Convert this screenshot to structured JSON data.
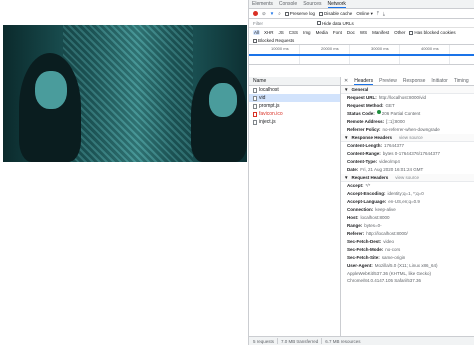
{
  "devtools": {
    "tabs": [
      "Elements",
      "Console",
      "Sources",
      "Network"
    ],
    "active_tab": "Network",
    "toolbar": {
      "preserve_log": "Preserve log",
      "disable_cache": "Disable cache",
      "throttle": "Online"
    },
    "filter": {
      "placeholder": "Filter",
      "hide_data_urls": "Hide data URLs"
    },
    "types": [
      "All",
      "XHR",
      "JS",
      "CSS",
      "Img",
      "Media",
      "Font",
      "Doc",
      "WS",
      "Manifest",
      "Other"
    ],
    "has_blocked_cookies": "Has blocked cookies",
    "blocked_requests": "Blocked Requests",
    "timeline_ticks": [
      "10000 ms",
      "20000 ms",
      "30000 ms",
      "40000 ms"
    ],
    "names_header": "Name",
    "requests": [
      {
        "name": "localhost"
      },
      {
        "name": "vid"
      },
      {
        "name": "prompt.js"
      },
      {
        "name": "favicon.ico"
      },
      {
        "name": "inject.js"
      }
    ],
    "detail_tabs": [
      "Headers",
      "Preview",
      "Response",
      "Initiator",
      "Timing"
    ],
    "general_title": "General",
    "general": [
      {
        "k": "Request URL:",
        "v": "http://localhost:8000/vid"
      },
      {
        "k": "Request Method:",
        "v": "GET"
      },
      {
        "k": "Status Code:",
        "v": "206 Partial Content"
      },
      {
        "k": "Remote Address:",
        "v": "[::1]:8000"
      },
      {
        "k": "Referrer Policy:",
        "v": "no-referrer-when-downgrade"
      }
    ],
    "response_title": "Response Headers",
    "view_source": "view source",
    "response_headers": [
      {
        "k": "Content-Length:",
        "v": "17644377"
      },
      {
        "k": "Content-Range:",
        "v": "bytes 0-17644376/17644377"
      },
      {
        "k": "Content-Type:",
        "v": "video/mp4"
      },
      {
        "k": "Date:",
        "v": "Fri, 21 Aug 2020 16:01:24 GMT"
      }
    ],
    "request_title": "Request Headers",
    "request_headers": [
      {
        "k": "Accept:",
        "v": "*/*"
      },
      {
        "k": "Accept-Encoding:",
        "v": "identity;q=1, *;q=0"
      },
      {
        "k": "Accept-Language:",
        "v": "en-US,en;q=0.9"
      },
      {
        "k": "Connection:",
        "v": "keep-alive"
      },
      {
        "k": "Host:",
        "v": "localhost:8000"
      },
      {
        "k": "Range:",
        "v": "bytes=0-"
      },
      {
        "k": "Referer:",
        "v": "http://localhost:8000/"
      },
      {
        "k": "Sec-Fetch-Dest:",
        "v": "video"
      },
      {
        "k": "Sec-Fetch-Mode:",
        "v": "no-cors"
      },
      {
        "k": "Sec-Fetch-Site:",
        "v": "same-origin"
      }
    ],
    "user_agent": {
      "k": "User-Agent:",
      "v": "Mozilla/5.0 (X11; Linux x86_64) AppleWebKit/537.36 (KHTML, like Gecko) Chrome/84.0.4147.105 Safari/537.36"
    },
    "status_bar": {
      "requests": "5 requests",
      "transferred": "7.0 MB transferred",
      "resources": "6.7 MB resources"
    },
    "colors": {
      "accent": "#1a73e8",
      "record": "#d93025",
      "error": "#d93025",
      "ok": "#1e8e3e"
    }
  }
}
